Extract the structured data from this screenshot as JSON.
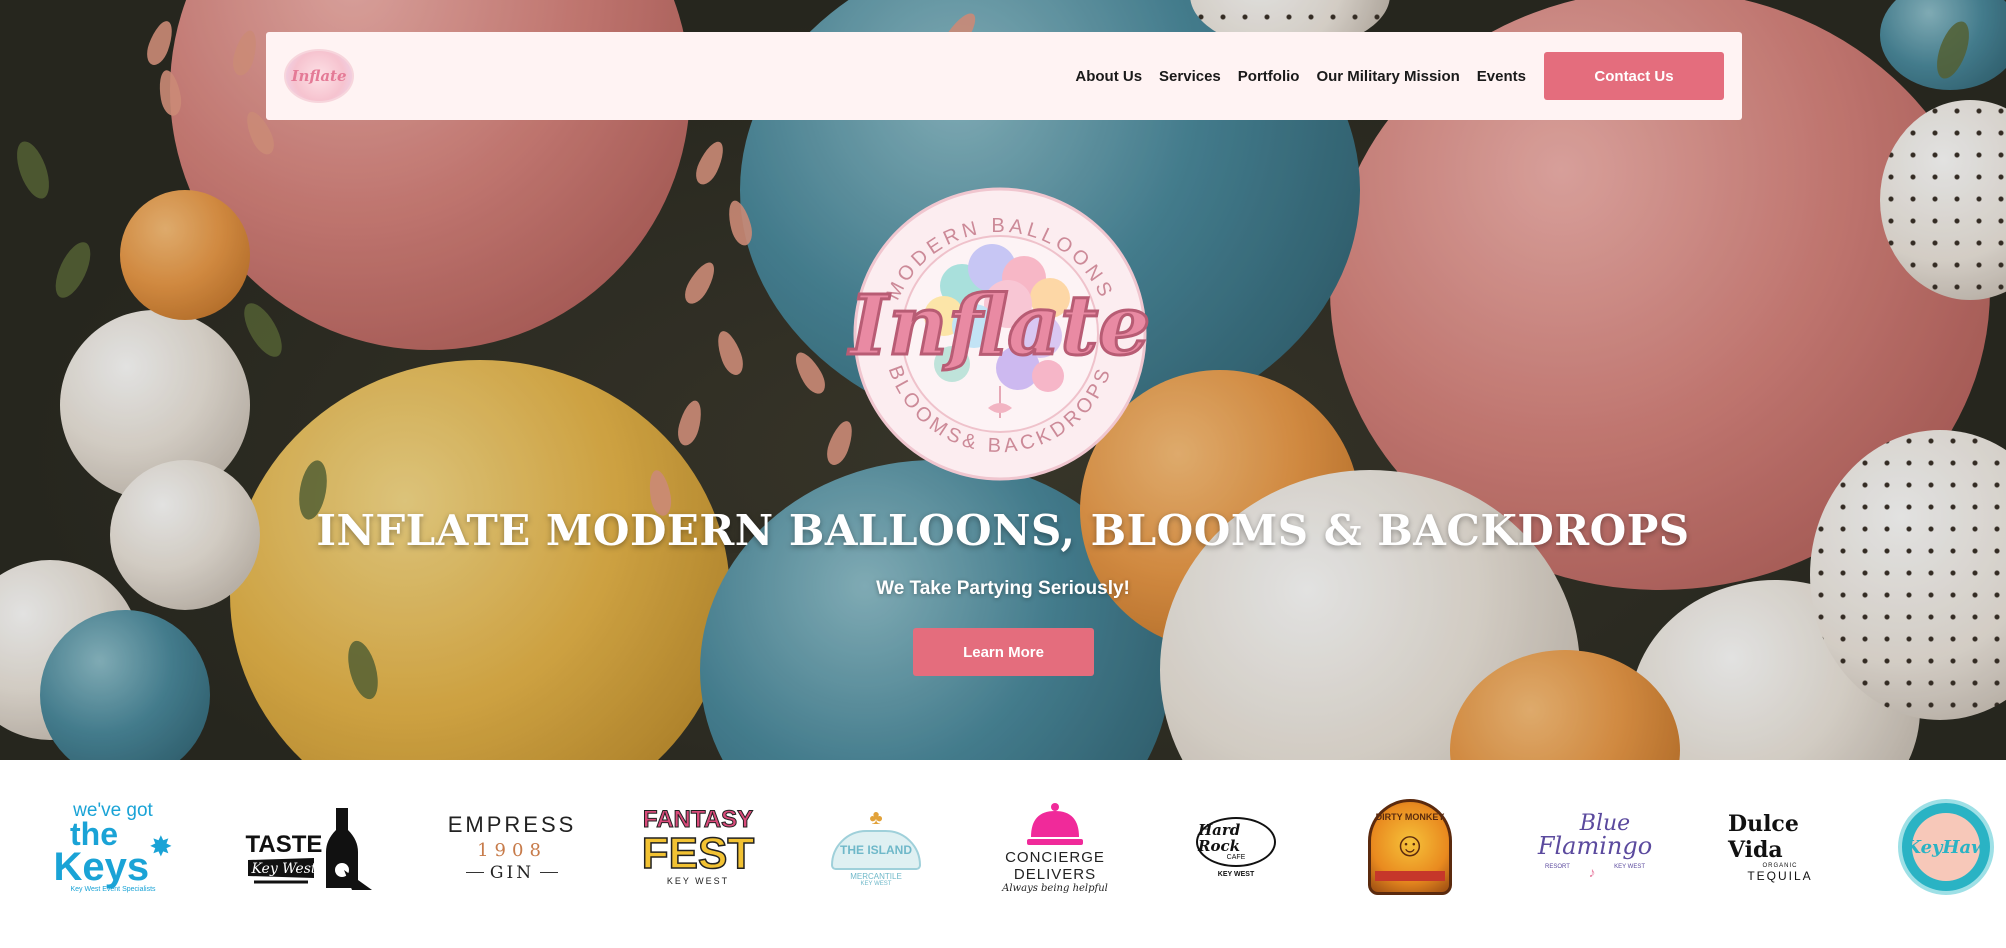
{
  "nav": {
    "logo_text": "Inflate",
    "links": [
      {
        "label": "About Us"
      },
      {
        "label": "Services"
      },
      {
        "label": "Portfolio"
      },
      {
        "label": "Our Military Mission"
      },
      {
        "label": "Events"
      }
    ],
    "contact_label": "Contact Us"
  },
  "hero": {
    "logo": {
      "ring_top": "MODERN BALLOONS",
      "ring_bottom": "BLOOMS& BACKDROPS",
      "word": "Inflate"
    },
    "title": "INFLATE MODERN BALLOONS, BLOOMS & BACKDROPS",
    "subtitle": "We Take Partying Seriously!",
    "cta_label": "Learn More"
  },
  "partners": {
    "keys": {
      "line1": "we've got",
      "line2": "the",
      "line3": "Keys",
      "tag": "Key West Event Specialists"
    },
    "taste": {
      "line1": "TASTE",
      "line2": "Key West"
    },
    "empress": {
      "line1": "EMPRESS",
      "line2": "1908",
      "line3": "GIN"
    },
    "fantasy": {
      "line1": "FANTASY",
      "line2": "FEST",
      "line3": "KEY WEST"
    },
    "island": {
      "line1": "THE ISLAND",
      "line2": "MERCANTILE",
      "line3": "KEY WEST"
    },
    "concierge": {
      "line1": "CONCIERGE",
      "line2": "DELIVERS",
      "line3": "Always being helpful"
    },
    "hardrock": {
      "line1": "Hard Rock",
      "line2": "CAFE",
      "line3": "KEY WEST"
    },
    "monkey": {
      "line1": "DIRTY MONKEY"
    },
    "flamingo": {
      "line1": "Blue",
      "line2": "Flamingo",
      "line3": "RESORT",
      "line4": "KEY WEST"
    },
    "dulce": {
      "line1": "Dulce Vida",
      "line2": "ORGANIC",
      "line3": "TEQUILA"
    },
    "keyhaw": {
      "line1": "KeyHaw"
    }
  },
  "colors": {
    "accent": "#e46d7d",
    "nav_bg": "#fff3f3",
    "keys_blue": "#1aa3d6",
    "concierge_pink": "#f02a9a",
    "keyhaw_teal": "#2ab3c4"
  }
}
